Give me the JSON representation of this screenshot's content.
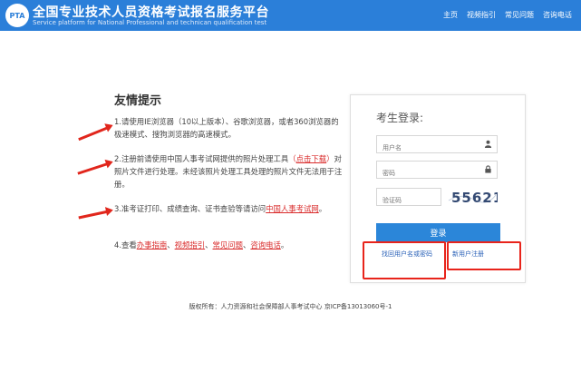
{
  "header": {
    "logo_text": "PTA",
    "title": "全国专业技术人员资格考试报名服务平台",
    "subtitle": "Service platform for National Professional and technican qualification test",
    "nav": [
      "主页",
      "视频指引",
      "常见问题",
      "咨询电话"
    ]
  },
  "notice": {
    "title": "友情提示",
    "item1": "1.请使用IE浏览器（10以上版本）、谷歌浏览器，或者360浏览器的极速模式、搜狗浏览器的高速模式。",
    "item2_a": "2.注册前请使用中国人事考试网提供的照片处理工具",
    "item2_link": "点击下载",
    "item2_b": "对照片文件进行处理。未经该照片处理工具处理的照片文件无法用于注册。",
    "item3_a": "3.准考证打印、成绩查询、证书查验等请访问",
    "item3_link": "中国人事考试网",
    "item3_b": "。",
    "item4_a": "4.查看",
    "item4_links": [
      "办事指南",
      "视频指引",
      "常见问题",
      "咨询电话"
    ],
    "item4_end": "。"
  },
  "login": {
    "title": "考生登录:",
    "username_placeholder": "用户名",
    "password_placeholder": "密码",
    "captcha_placeholder": "验证码",
    "captcha_code": "55621",
    "login_button": "登录",
    "forgot_link": "找回用户名或密码",
    "register_link": "新用户注册"
  },
  "footer": {
    "text": "版权所有：人力资源和社会保障部人事考试中心 京ICP备13013060号-1"
  },
  "colors": {
    "header_bg": "#2b7fd9",
    "accent": "#2b86d9",
    "highlight_red": "#e8241b"
  }
}
